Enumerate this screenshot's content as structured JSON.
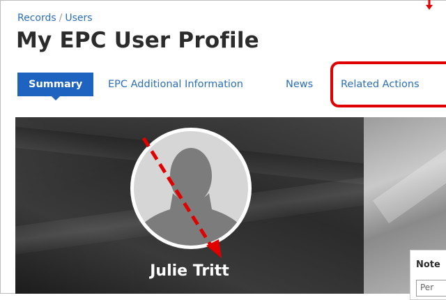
{
  "breadcrumb": {
    "root": "Records",
    "separator": "/",
    "current": "Users"
  },
  "page": {
    "title": "My EPC User Profile"
  },
  "tabs": [
    {
      "label": "Summary",
      "active": true
    },
    {
      "label": "EPC Additional Information",
      "active": false
    },
    {
      "label": "News",
      "active": false
    },
    {
      "label": "Related Actions",
      "active": false
    }
  ],
  "profile": {
    "name": "Julie Tritt",
    "avatar_icon": "person-silhouette-icon"
  },
  "notes": {
    "title": "Note",
    "input_value": "Per"
  },
  "annotations": {
    "highlight_target": "Related Actions",
    "color": "#e00000"
  },
  "colors": {
    "accent": "#1f63c0",
    "link": "#2a6eb8"
  }
}
